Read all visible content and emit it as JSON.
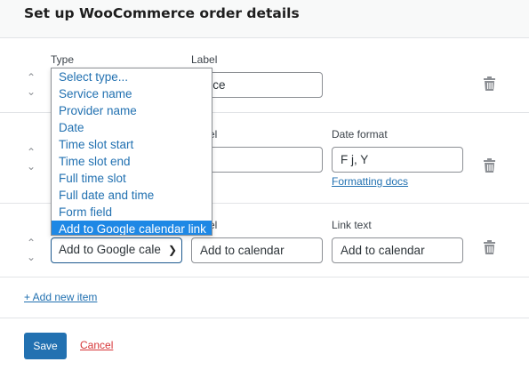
{
  "header": {
    "title": "Set up WooCommerce order details"
  },
  "labels": {
    "type": "Type",
    "label": "Label",
    "label_partial": "el",
    "date_format": "Date format",
    "link_text": "Link text"
  },
  "rows": [
    {
      "label_value": "rvice"
    },
    {
      "label_value": "te",
      "date_format_value": "F j, Y",
      "formatting_docs": "Formatting docs"
    },
    {
      "type_value": "Add to Google cale",
      "label_value": "Add to calendar",
      "link_text_value": "Add to calendar"
    }
  ],
  "dropdown": {
    "options": [
      "Select type...",
      "Service name",
      "Provider name",
      "Date",
      "Time slot start",
      "Time slot end",
      "Full time slot",
      "Full date and time",
      "Form field",
      "Add to Google calendar link"
    ],
    "selected": "Add to Google calendar link"
  },
  "add_new_item": "+ Add new item",
  "buttons": {
    "save": "Save",
    "cancel": "Cancel"
  },
  "colors": {
    "accent": "#2271b1",
    "selected_option": "#1e88e5",
    "cancel": "#d63638"
  }
}
